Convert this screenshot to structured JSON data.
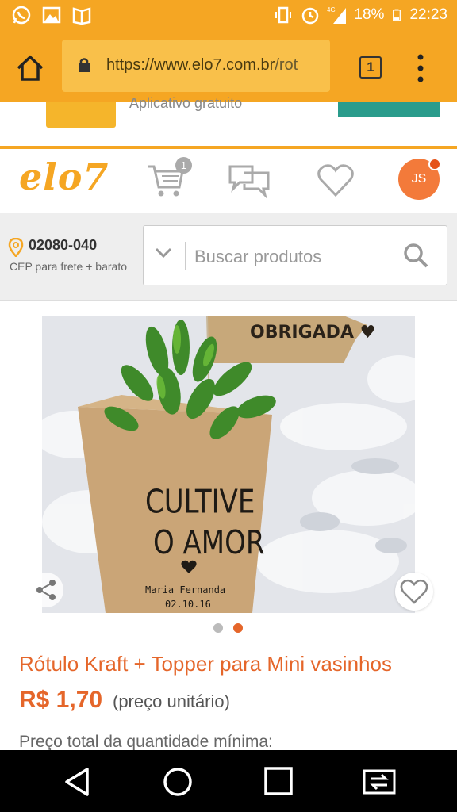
{
  "status_bar": {
    "battery": "18%",
    "time": "22:23",
    "network": "4G",
    "icons_left": [
      "whatsapp-icon",
      "image-icon",
      "book-icon"
    ],
    "icons_right": [
      "vibrate-icon",
      "alarm-icon",
      "signal-icon",
      "battery-icon"
    ]
  },
  "browser": {
    "url_main": "https://www.elo7.com.br",
    "url_rest": "/rot",
    "tab_count": "1"
  },
  "banner": {
    "text": "Aplicativo gratuito"
  },
  "header": {
    "logo": "elo7",
    "cart_count": "1",
    "avatar_initials": "JS"
  },
  "search": {
    "cep": "02080-040",
    "cep_subtitle": "CEP para frete + barato",
    "placeholder": "Buscar produtos"
  },
  "product": {
    "image_text": {
      "tag": "OBRIGADA ♥",
      "line1": "CULTIVE",
      "line2": "O AMOR",
      "name": "Maria Fernanda",
      "date": "02.10.16"
    },
    "carousel_dots": 2,
    "carousel_active": 2,
    "title": "Rótulo Kraft + Topper para Mini vasinhos",
    "price": "R$ 1,70",
    "unit_label": "(preço unitário)",
    "total_label": "Preço total da quantidade mínima:"
  },
  "colors": {
    "brand_orange": "#f5a623",
    "accent": "#e5662a",
    "teal": "#2a9c8c"
  }
}
